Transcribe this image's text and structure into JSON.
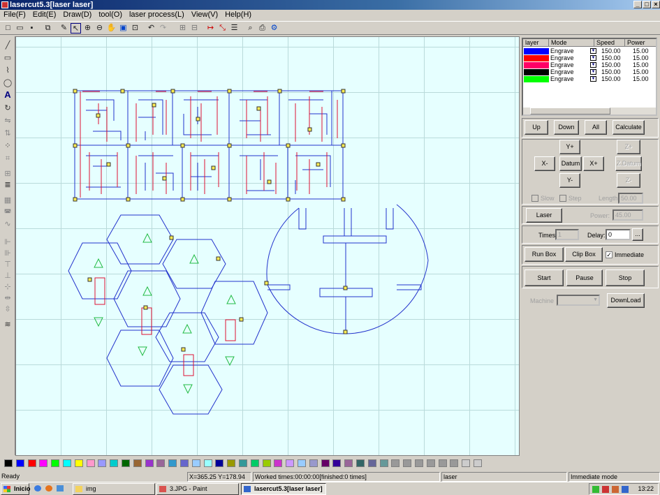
{
  "window": {
    "title": "lasercut5.3[laser laser]"
  },
  "menu": [
    "File(F)",
    "Edit(E)",
    "Draw(D)",
    "tool(O)",
    "laser process(L)",
    "View(V)",
    "Help(H)"
  ],
  "toolbar_icons": [
    "new-icon",
    "open-icon",
    "save-icon",
    "import-icon",
    "pen-icon",
    "select-icon",
    "zoom-in-icon",
    "zoom-out-icon",
    "pan-icon",
    "zoom-window-icon",
    "zoom-fit-icon",
    "undo-icon",
    "redo-icon",
    "group-icon",
    "ungroup-icon",
    "cut-path-icon",
    "node-icon",
    "array-icon",
    "preview-icon",
    "output-icon",
    "settings-icon"
  ],
  "layers": {
    "headers": [
      "layer",
      "Mode",
      "Speed",
      "Power"
    ],
    "rows": [
      {
        "color": "#0000ff",
        "mode": "Engrave",
        "speed": "150.00",
        "power": "15.00"
      },
      {
        "color": "#ff0000",
        "mode": "Engrave",
        "speed": "150.00",
        "power": "15.00"
      },
      {
        "color": "#ff0066",
        "mode": "Engrave",
        "speed": "150.00",
        "power": "15.00"
      },
      {
        "color": "#000000",
        "mode": "Engrave",
        "speed": "150.00",
        "power": "15.00"
      },
      {
        "color": "#00ff00",
        "mode": "Engrave",
        "speed": "150.00",
        "power": "15.00"
      }
    ]
  },
  "order_buttons": {
    "up": "Up",
    "down": "Down",
    "all": "All",
    "calculate": "Calculate"
  },
  "jog": {
    "yplus": "Y+",
    "xminus": "X-",
    "datum": "Datum",
    "xplus": "X+",
    "yminus": "Y-",
    "zplus": "Z+",
    "zdatum": "Z.Datum",
    "zminus": "Z-"
  },
  "jog_options": {
    "slow": "Slow",
    "step": "Step",
    "length_label": "Length",
    "length_value": "50.00"
  },
  "laser": {
    "button": "Laser",
    "power_label": "Power:",
    "power_value": "45.00"
  },
  "times": {
    "label": "Times:",
    "value": "1",
    "delay_label": "Delay:",
    "delay_value": "0",
    "browse": "..."
  },
  "box": {
    "run": "Run Box",
    "clip": "Clip Box",
    "immediate": "Immediate"
  },
  "run": {
    "start": "Start",
    "pause": "Pause",
    "stop": "Stop"
  },
  "machine": {
    "label": "Machine",
    "download": "DownLoad"
  },
  "palette": [
    "#000000",
    "#0000ff",
    "#ff0000",
    "#ff00ff",
    "#00ff00",
    "#00ffff",
    "#ffff00",
    "#ff99cc",
    "#9999ff",
    "#00cccc",
    "#006600",
    "#996633",
    "#9933cc",
    "#996699",
    "#3399cc",
    "#6666cc",
    "#99ccff",
    "#99ffff",
    "#000099",
    "#999900",
    "#339999",
    "#00cc66",
    "#99cc00",
    "#cc33cc",
    "#cc99ff",
    "#99ccff",
    "#9999cc",
    "#660066",
    "#330099",
    "#996699",
    "#336666",
    "#666699",
    "#669999",
    "#999999",
    "#999999",
    "#999999",
    "#999999",
    "#999999",
    "#999999",
    "#cccccc",
    "#cccccc"
  ],
  "status": {
    "ready": "Ready",
    "coords": "X=365.25 Y=178.94",
    "worked": "Worked times:00:00:00[finished:0 times]",
    "layer": "laser",
    "mode": "Immediate mode"
  },
  "taskbar": {
    "start": "Inicio",
    "tasks": [
      "img",
      "3.JPG - Paint",
      "lasercut5.3[laser laser]"
    ],
    "clock": "13:22"
  }
}
